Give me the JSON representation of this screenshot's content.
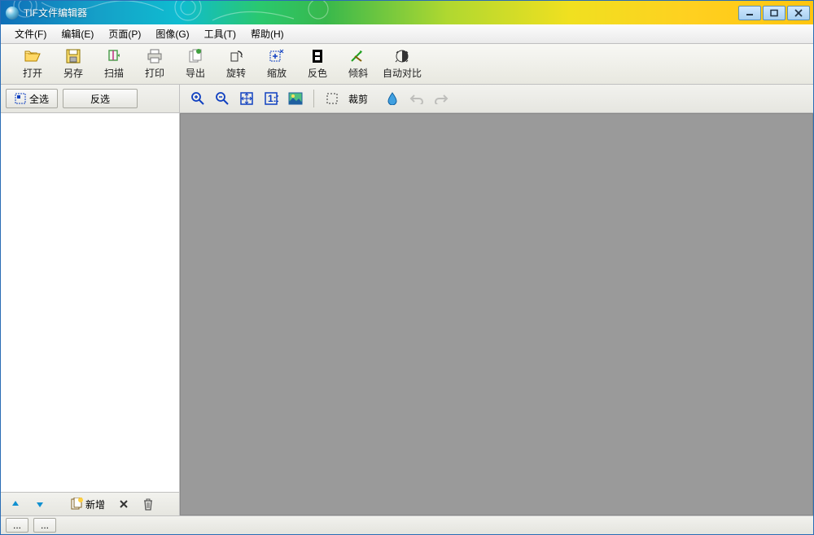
{
  "window": {
    "title": "TIF文件编辑器"
  },
  "menu": {
    "file": "文件(F)",
    "edit": "编辑(E)",
    "page": "页面(P)",
    "image": "图像(G)",
    "tools": "工具(T)",
    "help": "帮助(H)"
  },
  "toolbar": {
    "open": "打开",
    "save_as": "另存",
    "scan": "扫描",
    "print": "打印",
    "export": "导出",
    "rotate": "旋转",
    "zoom": "缩放",
    "invert": "反色",
    "skew": "倾斜",
    "auto_contrast": "自动对比"
  },
  "selection": {
    "select_all": "全选",
    "invert_selection": "反选"
  },
  "viewtools": {
    "crop": "裁剪"
  },
  "sidebar": {
    "new": "新增"
  },
  "status": {
    "cell1": "...",
    "cell2": "..."
  }
}
